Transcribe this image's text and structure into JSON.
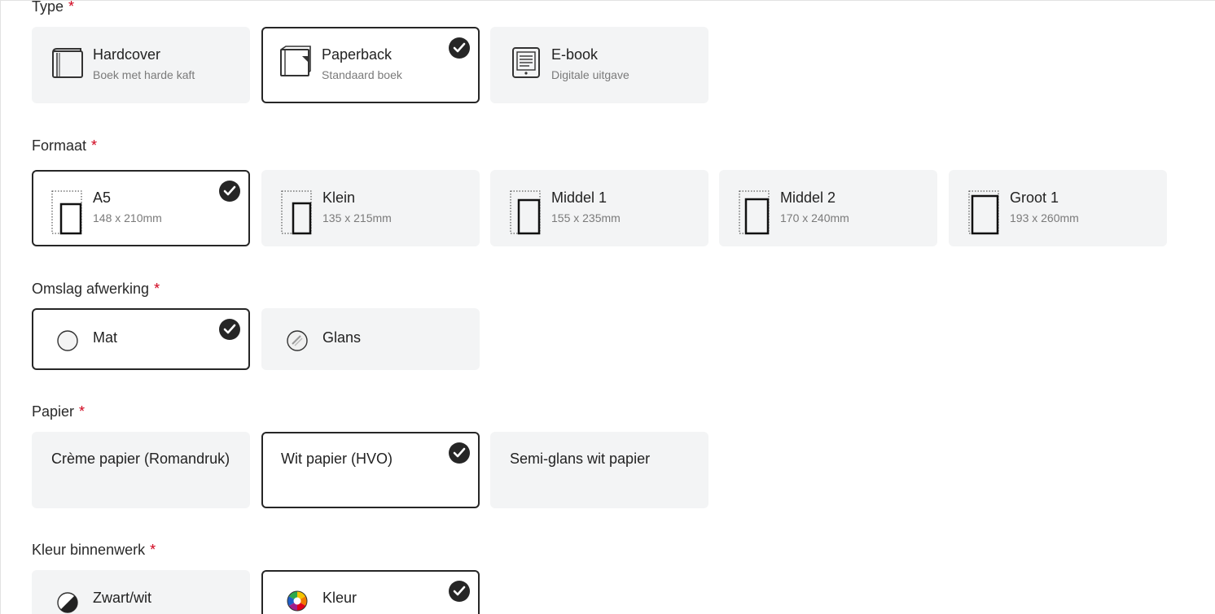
{
  "sections": {
    "type": {
      "label": "Type",
      "required_mark": "*",
      "options": [
        {
          "title": "Hardcover",
          "subtitle": "Boek met harde kaft",
          "icon": "hardcover-book-icon",
          "selected": false
        },
        {
          "title": "Paperback",
          "subtitle": "Standaard boek",
          "icon": "paperback-book-icon",
          "selected": true
        },
        {
          "title": "E-book",
          "subtitle": "Digitale uitgave",
          "icon": "ereader-icon",
          "selected": false
        }
      ]
    },
    "formaat": {
      "label": "Formaat",
      "required_mark": "*",
      "options": [
        {
          "title": "A5",
          "subtitle": "148 x 210mm",
          "icon": "page-size-icon",
          "selected": true
        },
        {
          "title": "Klein",
          "subtitle": "135 x 215mm",
          "icon": "page-size-icon",
          "selected": false
        },
        {
          "title": "Middel 1",
          "subtitle": "155 x 235mm",
          "icon": "page-size-icon",
          "selected": false
        },
        {
          "title": "Middel 2",
          "subtitle": "170 x 240mm",
          "icon": "page-size-icon",
          "selected": false
        },
        {
          "title": "Groot 1",
          "subtitle": "193 x 260mm",
          "icon": "page-size-icon",
          "selected": false
        }
      ]
    },
    "omslag": {
      "label": "Omslag afwerking",
      "required_mark": "*",
      "options": [
        {
          "title": "Mat",
          "icon": "matte-circle-icon",
          "selected": true
        },
        {
          "title": "Glans",
          "icon": "gloss-circle-icon",
          "selected": false
        }
      ]
    },
    "papier": {
      "label": "Papier",
      "required_mark": "*",
      "options": [
        {
          "title": "Crème papier (Romandruk)",
          "selected": false
        },
        {
          "title": "Wit papier (HVO)",
          "selected": true
        },
        {
          "title": "Semi-glans wit papier",
          "selected": false
        }
      ]
    },
    "kleur": {
      "label": "Kleur binnenwerk",
      "required_mark": "*",
      "options": [
        {
          "title": "Zwart/wit",
          "icon": "black-white-icon",
          "selected": false
        },
        {
          "title": "Kleur",
          "icon": "color-wheel-icon",
          "selected": true
        }
      ]
    }
  },
  "colors": {
    "selected_border": "#262626",
    "card_background": "#f3f4f5",
    "required_mark": "#d0021b",
    "subtitle_text": "#7a7a7a"
  }
}
